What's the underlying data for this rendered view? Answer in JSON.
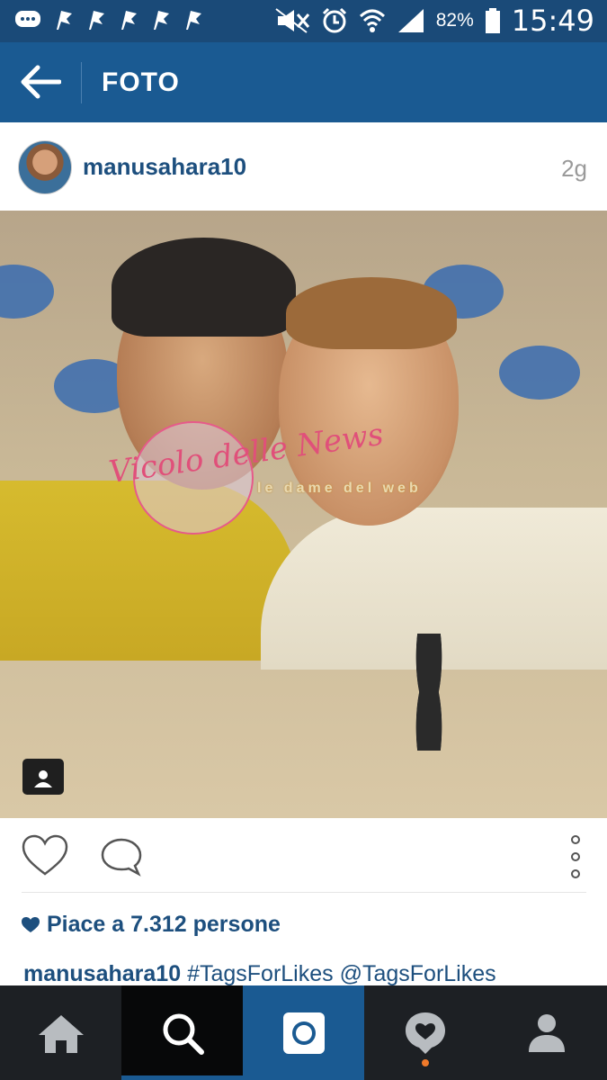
{
  "status_bar": {
    "battery_percent": "82%",
    "time": "15:49"
  },
  "header": {
    "title": "FOTO"
  },
  "post": {
    "username": "manusahara10",
    "age": "2g",
    "likes_text": "Piace a 7.312 persone",
    "caption_user": "manusahara10",
    "caption_text": "#TagsForLikes @TagsForLikes"
  },
  "photo_watermarks": {
    "circle_text": "Vicolo delle News",
    "banner_text": "le dame del web"
  },
  "bottom_nav": {
    "items": [
      "home-icon",
      "search-icon",
      "camera-icon",
      "activity-icon",
      "profile-icon"
    ],
    "active": "search-icon"
  },
  "colors": {
    "status_bar": "#1a4a78",
    "header": "#1a5a92",
    "link_blue": "#1d4f7e",
    "nav_bg": "#1d2024",
    "notif_dot": "#f07a2a"
  }
}
